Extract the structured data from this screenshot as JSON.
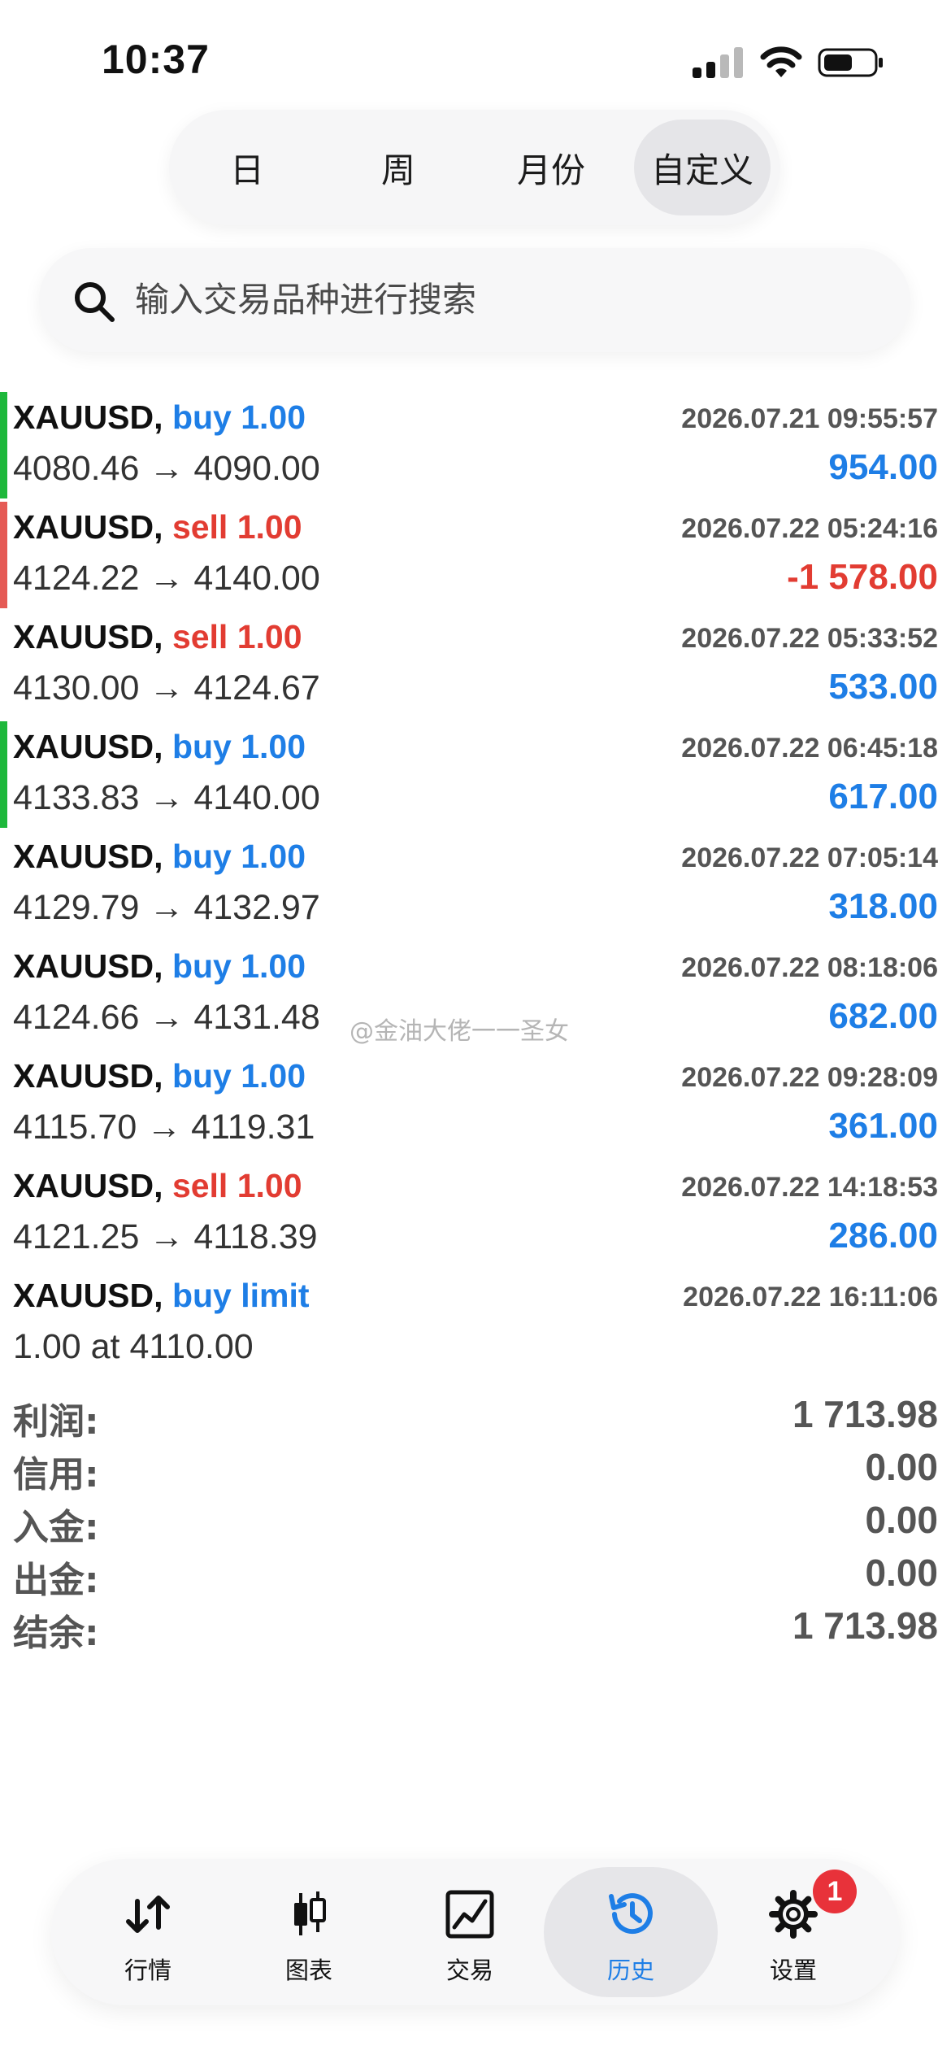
{
  "status_bar": {
    "time": "10:37"
  },
  "period_tabs": [
    {
      "label": "日"
    },
    {
      "label": "周"
    },
    {
      "label": "月份"
    },
    {
      "label": "自定义"
    }
  ],
  "search": {
    "placeholder": "输入交易品种进行搜索"
  },
  "deals": [
    {
      "symbol": "XAUUSD,",
      "type": "buy 1.00",
      "direction": "buy",
      "datetime": "2026.07.21 09:55:57",
      "prices": "4080.46 → 4090.00",
      "profit": "954.00",
      "indicator_color": "#1db83b"
    },
    {
      "symbol": "XAUUSD,",
      "type": "sell 1.00",
      "direction": "sell",
      "datetime": "2026.07.22 05:24:16",
      "prices": "4124.22 → 4140.00",
      "profit": "-1 578.00",
      "indicator_color": "#e55a55"
    },
    {
      "symbol": "XAUUSD,",
      "type": "sell 1.00",
      "direction": "sell",
      "datetime": "2026.07.22 05:33:52",
      "prices": "4130.00 → 4124.67",
      "profit": "533.00",
      "indicator_color": ""
    },
    {
      "symbol": "XAUUSD,",
      "type": "buy 1.00",
      "direction": "buy",
      "datetime": "2026.07.22 06:45:18",
      "prices": "4133.83 → 4140.00",
      "profit": "617.00",
      "indicator_color": "#1db83b"
    },
    {
      "symbol": "XAUUSD,",
      "type": "buy 1.00",
      "direction": "buy",
      "datetime": "2026.07.22 07:05:14",
      "prices": "4129.79 → 4132.97",
      "profit": "318.00",
      "indicator_color": ""
    },
    {
      "symbol": "XAUUSD,",
      "type": "buy 1.00",
      "direction": "buy",
      "datetime": "2026.07.22 08:18:06",
      "prices": "4124.66 → 4131.48",
      "profit": "682.00",
      "indicator_color": ""
    },
    {
      "symbol": "XAUUSD,",
      "type": "buy 1.00",
      "direction": "buy",
      "datetime": "2026.07.22 09:28:09",
      "prices": "4115.70 → 4119.31",
      "profit": "361.00",
      "indicator_color": ""
    },
    {
      "symbol": "XAUUSD,",
      "type": "sell 1.00",
      "direction": "sell",
      "datetime": "2026.07.22 14:18:53",
      "prices": "4121.25 → 4118.39",
      "profit": "286.00",
      "indicator_color": ""
    },
    {
      "symbol": "XAUUSD,",
      "type": "buy limit",
      "direction": "buy",
      "datetime": "2026.07.22 16:11:06",
      "prices": "1.00 at 4110.00",
      "profit": "",
      "indicator_color": ""
    }
  ],
  "watermark": "@金油大佬一一圣女",
  "summary": [
    {
      "label": "利润:",
      "value": "1 713.98"
    },
    {
      "label": "信用:",
      "value": "0.00"
    },
    {
      "label": "入金:",
      "value": "0.00"
    },
    {
      "label": "出金:",
      "value": "0.00"
    },
    {
      "label": "结余:",
      "value": "1 713.98"
    }
  ],
  "bottom_tabs": [
    {
      "label": "行情",
      "icon": "quotes-arrows-icon"
    },
    {
      "label": "图表",
      "icon": "candlestick-chart-icon"
    },
    {
      "label": "交易",
      "icon": "trade-chart-icon"
    },
    {
      "label": "历史",
      "icon": "history-clock-icon"
    },
    {
      "label": "设置",
      "icon": "settings-gear-icon"
    }
  ],
  "settings_badge": "1",
  "colors": {
    "accent_blue": "#1e7ee6",
    "sell_red": "#e23c32",
    "profit_blue": "#1e7ee6",
    "loss_red": "#e23c32"
  }
}
